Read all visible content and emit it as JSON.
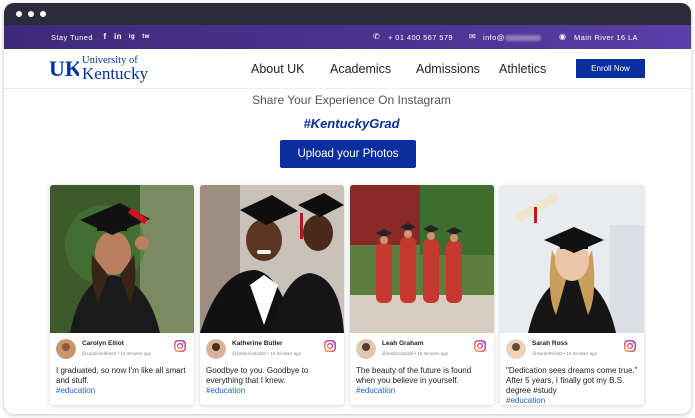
{
  "topbar": {
    "stay_tuned": "Stay Tuned",
    "social": [
      "f",
      "in",
      "ig",
      "tw"
    ],
    "phone": "+ 01 400 567 579",
    "email": "info@",
    "address": "Main River 16 LA"
  },
  "nav": {
    "logo_line1": "University of",
    "logo_line2": "Kentucky",
    "links": [
      "About UK",
      "Academics",
      "Admissions",
      "Athletics"
    ],
    "enroll": "Enroll Now"
  },
  "hero": {
    "share": "Share Your Experience On Instagram",
    "hashtag": "#KentuckyGrad",
    "upload": "Upload your Photos"
  },
  "cards": [
    {
      "name": "Carolyn Elliot",
      "meta": "@carolinedlkstch • 15 minutes ago",
      "caption": "I graduated, so now I'm like all smart and stuff.",
      "tag": "#education"
    },
    {
      "name": "Katherine Butler",
      "meta": "@katherinebutler • 15 minutes ago",
      "caption": "Goodbye to you. Goodbye to everything that I knew.",
      "tag": "#education"
    },
    {
      "name": "Leah Graham",
      "meta": "@leahGrahamll • 15 minutes ago",
      "caption": "The beauty of the future is found when you believe in yourself.",
      "tag": "#education"
    },
    {
      "name": "Sarah Ross",
      "meta": "@SarahRossO • 15 minutes ago",
      "caption": "\"Dedication sees dreams come true.\" After 5 years, I finally got my B.S. degree #study",
      "tag": "#education"
    }
  ],
  "colors": {
    "accent": "#0b2e9e",
    "topbar": "#4a3290",
    "hashtag_link": "#1e62c8"
  }
}
